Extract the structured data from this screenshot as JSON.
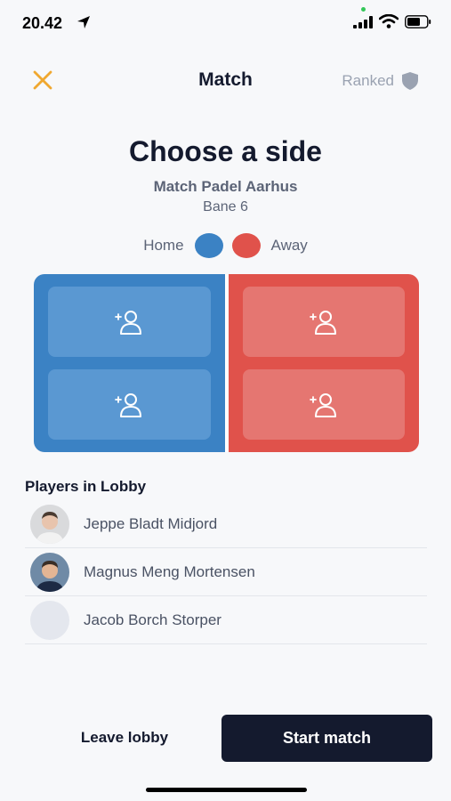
{
  "status_bar": {
    "time": "20.42",
    "icons": [
      "location-arrow-icon",
      "signal-icon",
      "wifi-icon",
      "battery-icon"
    ]
  },
  "header": {
    "title": "Match",
    "close_icon": "close-icon",
    "ranked_label": "Ranked",
    "ranked_icon": "shield-icon"
  },
  "main": {
    "title": "Choose a side",
    "subtitle": "Match Padel Aarhus",
    "court": "Bane 6"
  },
  "legend": {
    "home_label": "Home",
    "away_label": "Away"
  },
  "colors": {
    "home": "#3b82c4",
    "away": "#e0524b",
    "accent_close": "#f0a830",
    "primary_button": "#141a2e"
  },
  "court_slots": {
    "icon": "add-user-icon",
    "home": 2,
    "away": 2
  },
  "lobby": {
    "title": "Players in Lobby",
    "players": [
      {
        "name": "Jeppe Bladt Midjord",
        "avatar": "photo"
      },
      {
        "name": "Magnus Meng Mortensen",
        "avatar": "photo"
      },
      {
        "name": "Jacob Borch Storper",
        "avatar": "placeholder"
      }
    ]
  },
  "actions": {
    "leave_label": "Leave lobby",
    "start_label": "Start match"
  }
}
